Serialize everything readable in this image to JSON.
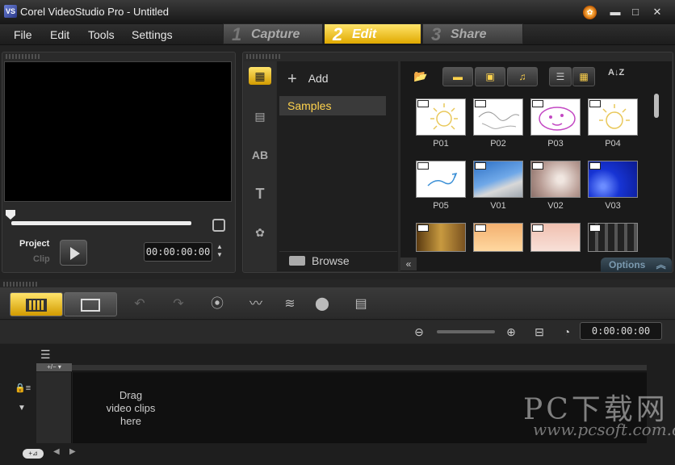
{
  "window": {
    "title": "Corel VideoStudio Pro - Untitled",
    "app_icon": "videostudio-icon",
    "controls": [
      "logo-icon",
      "minimize-icon",
      "maximize-icon",
      "close-icon"
    ]
  },
  "menu": {
    "items": [
      "File",
      "Edit",
      "Tools",
      "Settings"
    ]
  },
  "steps": [
    {
      "num": "1",
      "label": "Capture",
      "active": false
    },
    {
      "num": "2",
      "label": "Edit",
      "active": true
    },
    {
      "num": "3",
      "label": "Share",
      "active": false
    }
  ],
  "preview": {
    "project_label": "Project",
    "clip_label": "Clip",
    "timecode": "00:00:00:00"
  },
  "library": {
    "add_label": "Add",
    "folders": [
      "Samples"
    ],
    "browse_label": "Browse",
    "options_label": "Options",
    "thumbnails": [
      {
        "label": "P01",
        "kind": "photo"
      },
      {
        "label": "P02",
        "kind": "photo"
      },
      {
        "label": "P03",
        "kind": "photo"
      },
      {
        "label": "P04",
        "kind": "photo"
      },
      {
        "label": "P05",
        "kind": "photo"
      },
      {
        "label": "V01",
        "kind": "video"
      },
      {
        "label": "V02",
        "kind": "video"
      },
      {
        "label": "V03",
        "kind": "video"
      },
      {
        "label": "",
        "kind": "video"
      },
      {
        "label": "",
        "kind": "video"
      },
      {
        "label": "",
        "kind": "video"
      },
      {
        "label": "",
        "kind": "video"
      }
    ]
  },
  "timeline": {
    "timecode": "0:00:00:00",
    "drag_message": "Drag\nvideo clips\nhere"
  },
  "watermark": {
    "line1": "PC下载网",
    "line2": "www.pcsoft.com.cn"
  },
  "colors": {
    "accent": "#f5c400",
    "selected_text": "#ffd34d"
  }
}
